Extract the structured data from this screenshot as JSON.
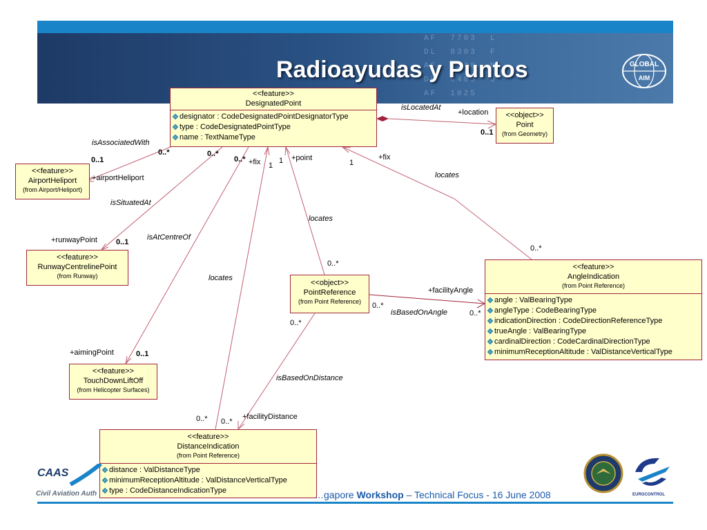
{
  "slide": {
    "title": "Radioayudas y Puntos",
    "logo_global": "GLOBAL",
    "logo_aim": "AIM",
    "departures_board": "AF  7703  L\nDL  8303  F\nAF  0500  N\nDL  8485  U\nAF  1025",
    "footer_prefix": "…gapore ",
    "footer_bold": "Workshop",
    "footer_suffix": " – Technical Focus - 16 June 2008",
    "caas_logo": "CAAS",
    "caas_name": "Civil Aviation Auth",
    "eurocontrol": "EUROCONTROL",
    "colors": {
      "accent": "#1a84c8",
      "box_fill": "#ffffcc",
      "line": "#a0223a"
    }
  },
  "diagram": {
    "classes": {
      "designated_point": {
        "stereotype": "<<feature>>",
        "name": "DesignatedPoint",
        "attributes": [
          {
            "name": "designator",
            "type": "CodeDesignatedPointDesignatorType"
          },
          {
            "name": "type",
            "type": "CodeDesignatedPointType"
          },
          {
            "name": "name",
            "type": "TextNameType"
          }
        ]
      },
      "point": {
        "stereotype": "<<object>>",
        "name": "Point",
        "from": "(from Geometry)"
      },
      "airport_heliport": {
        "stereotype": "<<feature>>",
        "name": "AirportHeliport",
        "from": "(from Airport/Heliport)"
      },
      "runway_centreline_point": {
        "stereotype": "<<feature>>",
        "name": "RunwayCentrelinePoint",
        "from": "(from Runway)"
      },
      "point_reference": {
        "stereotype": "<<object>>",
        "name": "PointReference",
        "from": "(from Point Reference)"
      },
      "angle_indication": {
        "stereotype": "<<feature>>",
        "name": "AngleIndication",
        "from": "(from Point Reference)",
        "attributes": [
          {
            "name": "angle",
            "type": "ValBearingType"
          },
          {
            "name": "angleType",
            "type": "CodeBearingType"
          },
          {
            "name": "indicationDirection",
            "type": "CodeDirectionReferenceType"
          },
          {
            "name": "trueAngle",
            "type": "ValBearingType"
          },
          {
            "name": "cardinalDirection",
            "type": "CodeCardinalDirectionType"
          },
          {
            "name": "minimumReceptionAltitude",
            "type": "ValDistanceVerticalType"
          }
        ]
      },
      "touch_down_lift_off": {
        "stereotype": "<<feature>>",
        "name": "TouchDownLiftOff",
        "from": "(from Helicopter Surfaces)"
      },
      "distance_indication": {
        "stereotype": "<<feature>>",
        "name": "DistanceIndication",
        "from": "(from Point Reference)",
        "attributes": [
          {
            "name": "distance",
            "type": "ValDistanceType"
          },
          {
            "name": "minimumReceptionAltitude",
            "type": "ValDistanceVerticalType"
          },
          {
            "name": "type",
            "type": "CodeDistanceIndicationType"
          }
        ]
      }
    },
    "labels": {
      "is_located_at": "isLocatedAt",
      "location": "+location",
      "point_mult": "0..1",
      "is_associated_with": "isAssociatedWith",
      "dp_mult_ah": "0..*",
      "ah_mult": "0..1",
      "airport_heliport_role": "+airportHeliport",
      "dp_mult_rcp": "0..*",
      "dp_mult_td": "0..*",
      "fix_1": "+fix",
      "one_1": "1",
      "one_2": "1",
      "point_role": "+point",
      "one_3": "1",
      "fix_2": "+fix",
      "locates_1": "locates",
      "is_situated_at": "isSituatedAt",
      "runway_point_role": "+runwayPoint",
      "rcp_mult": "0..1",
      "is_at_centre_of": "isAtCentreOf",
      "locates_2": "locates",
      "locates_3": "locates",
      "pr_mult_top": "0..*",
      "ai_mult_top": "0..*",
      "facility_angle": "+facilityAngle",
      "pr_mult_angle": "0..*",
      "is_based_on_angle": "isBasedOnAngle",
      "ai_mult_left": "0..*",
      "pr_mult_dist": "0..*",
      "aiming_point": "+aimingPoint",
      "td_mult": "0..1",
      "is_based_on_distance": "isBasedOnDistance",
      "di_mult_1": "0..*",
      "di_mult_2": "0..*",
      "facility_distance": "+facilityDistance"
    }
  }
}
